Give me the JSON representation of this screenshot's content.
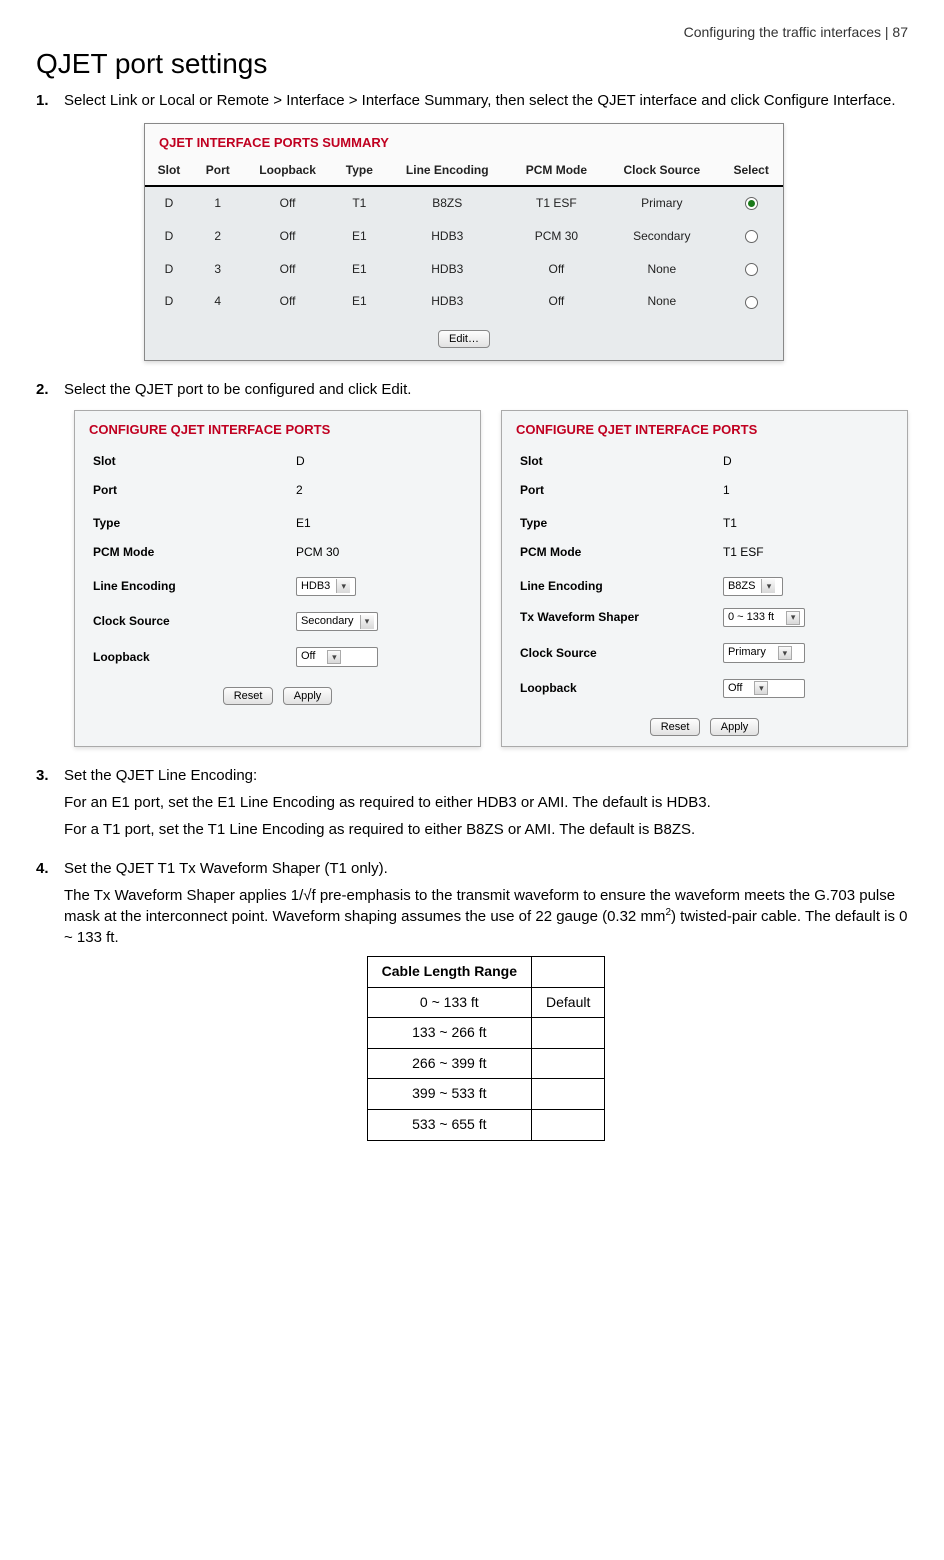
{
  "header": {
    "breadcrumb": "Configuring the traffic interfaces  |  87"
  },
  "title": "QJET port settings",
  "steps": {
    "s1": {
      "num": "1.",
      "text": "Select Link or Local or Remote > Interface > Interface Summary, then select the QJET interface and click Configure Interface."
    },
    "s2": {
      "num": "2.",
      "text": "Select the QJET port to be configured and click Edit."
    },
    "s3": {
      "num": "3.",
      "lead": "Set the QJET Line Encoding:",
      "p1": "For an E1 port, set the E1 Line Encoding as required to either HDB3 or AMI. The default is HDB3.",
      "p2": "For a T1 port, set the T1 Line Encoding as required to either B8ZS or AMI. The default is B8ZS."
    },
    "s4": {
      "num": "4.",
      "lead": "Set the QJET T1 Tx Waveform Shaper (T1 only).",
      "p1a": "The Tx Waveform Shaper applies 1/√f pre-emphasis to the transmit waveform to ensure the waveform meets the G.703 pulse mask at the interconnect point. Waveform shaping assumes the use of 22 gauge (0.32 mm",
      "p1sup": "2",
      "p1b": ") twisted-pair cable. The default is 0 ~ 133 ft."
    }
  },
  "summaryPanel": {
    "title": "QJET INTERFACE PORTS SUMMARY",
    "columns": [
      "Slot",
      "Port",
      "Loopback",
      "Type",
      "Line Encoding",
      "PCM Mode",
      "Clock Source",
      "Select"
    ],
    "rows": [
      {
        "slot": "D",
        "port": "1",
        "loopback": "Off",
        "type": "T1",
        "enc": "B8ZS",
        "pcm": "T1 ESF",
        "clock": "Primary",
        "selected": true
      },
      {
        "slot": "D",
        "port": "2",
        "loopback": "Off",
        "type": "E1",
        "enc": "HDB3",
        "pcm": "PCM 30",
        "clock": "Secondary",
        "selected": false
      },
      {
        "slot": "D",
        "port": "3",
        "loopback": "Off",
        "type": "E1",
        "enc": "HDB3",
        "pcm": "Off",
        "clock": "None",
        "selected": false
      },
      {
        "slot": "D",
        "port": "4",
        "loopback": "Off",
        "type": "E1",
        "enc": "HDB3",
        "pcm": "Off",
        "clock": "None",
        "selected": false
      }
    ],
    "editLabel": "Edit…"
  },
  "configLeft": {
    "title": "CONFIGURE QJET INTERFACE PORTS",
    "fields": {
      "slot": {
        "label": "Slot",
        "value": "D"
      },
      "port": {
        "label": "Port",
        "value": "2"
      },
      "type": {
        "label": "Type",
        "value": "E1"
      },
      "pcm": {
        "label": "PCM Mode",
        "value": "PCM 30"
      },
      "enc": {
        "label": "Line Encoding",
        "value": "HDB3"
      },
      "clock": {
        "label": "Clock Source",
        "value": "Secondary"
      },
      "loop": {
        "label": "Loopback",
        "value": "Off"
      }
    }
  },
  "configRight": {
    "title": "CONFIGURE QJET INTERFACE PORTS",
    "fields": {
      "slot": {
        "label": "Slot",
        "value": "D"
      },
      "port": {
        "label": "Port",
        "value": "1"
      },
      "type": {
        "label": "Type",
        "value": "T1"
      },
      "pcm": {
        "label": "PCM Mode",
        "value": "T1 ESF"
      },
      "enc": {
        "label": "Line Encoding",
        "value": "B8ZS"
      },
      "tx": {
        "label": "Tx Waveform Shaper",
        "value": "0 ~ 133 ft"
      },
      "clock": {
        "label": "Clock Source",
        "value": "Primary"
      },
      "loop": {
        "label": "Loopback",
        "value": "Off"
      }
    }
  },
  "buttons": {
    "reset": "Reset",
    "apply": "Apply"
  },
  "lengthTable": {
    "header": [
      "Cable Length Range",
      ""
    ],
    "rows": [
      {
        "range": "0 ~ 133 ft",
        "note": "Default"
      },
      {
        "range": "133 ~ 266 ft",
        "note": ""
      },
      {
        "range": "266 ~ 399 ft",
        "note": ""
      },
      {
        "range": "399 ~ 533 ft",
        "note": ""
      },
      {
        "range": "533 ~ 655 ft",
        "note": ""
      }
    ]
  }
}
